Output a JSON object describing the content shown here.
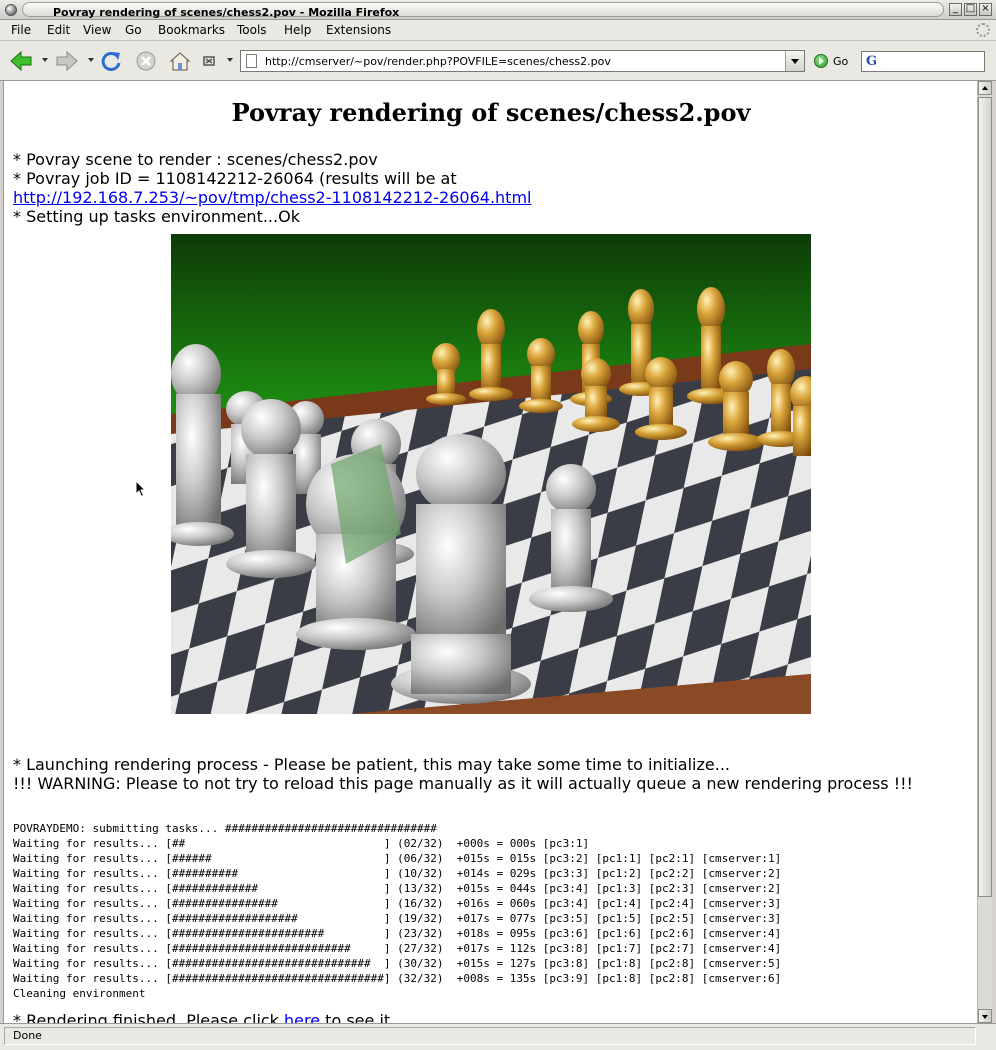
{
  "window": {
    "title": "Povray rendering of scenes/chess2.pov - Mozilla Firefox"
  },
  "menu": {
    "file": "File",
    "edit": "Edit",
    "view": "View",
    "go": "Go",
    "bookmarks": "Bookmarks",
    "tools": "Tools",
    "help": "Help",
    "extensions": "Extensions"
  },
  "toolbar": {
    "url": "http://cmserver/~pov/render.php?POVFILE=scenes/chess2.pov",
    "go_label": "Go",
    "search_value": ""
  },
  "page": {
    "title": "Povray rendering of scenes/chess2.pov",
    "scene_line": "* Povray scene to render : scenes/chess2.pov",
    "job_line": "* Povray job ID = 1108142212-26064 (results will be at",
    "results_link": "http://192.168.7.253/~pov/tmp/chess2-1108142212-26064.html",
    "setup_line": "* Setting up tasks environment...Ok",
    "launch_line": "* Launching rendering process - Please be patient, this may take some time to initialize...",
    "warning_line": "!!! WARNING: Please to not try to reload this page manually as it will actually queue a new rendering process !!!",
    "log": [
      "POVRAYDEMO: submitting tasks... ################################",
      "Waiting for results... [##                              ] (02/32)  +000s = 000s [pc3:1]",
      "Waiting for results... [######                          ] (06/32)  +015s = 015s [pc3:2] [pc1:1] [pc2:1] [cmserver:1]",
      "Waiting for results... [##########                      ] (10/32)  +014s = 029s [pc3:3] [pc1:2] [pc2:2] [cmserver:2]",
      "Waiting for results... [#############                   ] (13/32)  +015s = 044s [pc3:4] [pc1:3] [pc2:3] [cmserver:2]",
      "Waiting for results... [################                ] (16/32)  +016s = 060s [pc3:4] [pc1:4] [pc2:4] [cmserver:3]",
      "Waiting for results... [###################             ] (19/32)  +017s = 077s [pc3:5] [pc1:5] [pc2:5] [cmserver:3]",
      "Waiting for results... [#######################         ] (23/32)  +018s = 095s [pc3:6] [pc1:6] [pc2:6] [cmserver:4]",
      "Waiting for results... [###########################     ] (27/32)  +017s = 112s [pc3:8] [pc1:7] [pc2:7] [cmserver:4]",
      "Waiting for results... [##############################  ] (30/32)  +015s = 127s [pc3:8] [pc1:8] [pc2:8] [cmserver:5]",
      "Waiting for results... [################################] (32/32)  +008s = 135s [pc3:9] [pc1:8] [pc2:8] [cmserver:6]",
      "Cleaning environment"
    ],
    "finished_prefix": "* Rendering finished. Please click ",
    "finished_link": "here",
    "finished_suffix": " to see it."
  },
  "status": {
    "text": "Done"
  }
}
